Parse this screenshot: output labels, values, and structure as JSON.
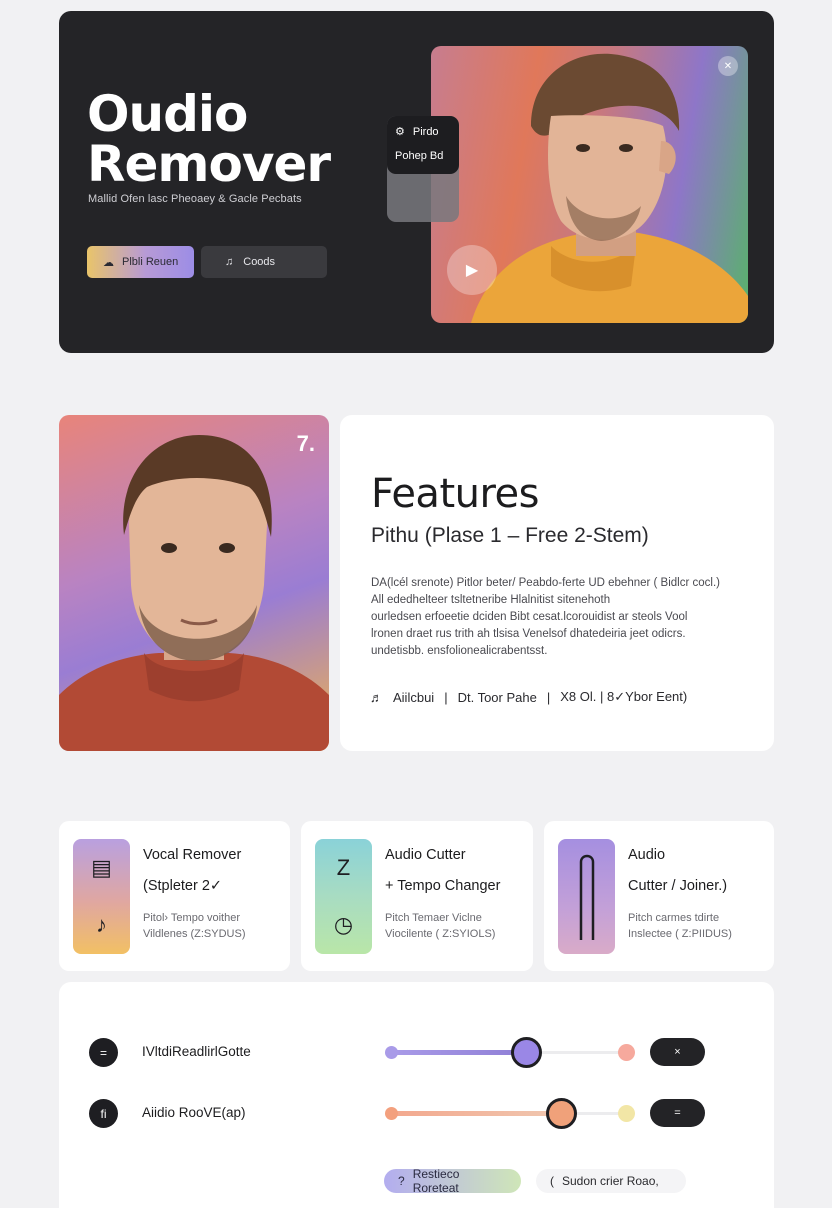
{
  "hero": {
    "title_line1": "Oudio",
    "title_line2": "Remover",
    "subtitle": "Mallid Ofen lasc Pheoaey & Gacle Pecbats",
    "primary_button": "Plbli Reuen",
    "secondary_button": "Coods",
    "float_label1": "Pirdo",
    "float_label2": "Pohep Bd"
  },
  "features": {
    "title": "Features",
    "subtitle": "Pithu (Plase 1 – Free 2-Stem)",
    "body_lines": [
      "DA(lcél srenote) Pitlor beter/ Peabdo-ferte UD ebehner ( Bidlcr cocl.)",
      "All ededhelteer tsltetneribe Hlalnitist sitenehoth",
      "ourledsen erfoeetie dciden Bibt cesat.lcorouidist ar steols Vool",
      "lronen draet rus trith ah tlsisa Venelsof dhatedeiria jeet odicrs.",
      "undetisbb. ensfolionealicrabentsst."
    ],
    "tag1": "Aiilcbui",
    "tag2": "Dt. Toor  Pahe",
    "tag3": "X8 Ol. | 8✓Ybor Eent)"
  },
  "tools": [
    {
      "line1": "Vocal Remover",
      "line2": "(Stpleter 2✓",
      "desc1": "Pitol› Tempo voither",
      "desc2": "Vildlenes (Z:SYDUS)"
    },
    {
      "line1": "Audio Cutter",
      "line2": "+ Tempo Changer",
      "desc1": "Pitch Temaer Viclne",
      "desc2": "Viocilente ( Z:SYIOLS)"
    },
    {
      "line1": "Audio",
      "line2": "Cutter / Joiner.)",
      "desc1": "Pitch carmes tdirte",
      "desc2": "Inslectee ( Z:PIIDUS)"
    }
  ],
  "controls": {
    "row1_label": "IVltdiReadlirlGotte",
    "row1_button": "×",
    "row1_value": 0.57,
    "row2_label": "Aiidio RooVE(ap)",
    "row2_button": "=",
    "row2_value": 0.72,
    "chip1": "Restieco Roreteat",
    "chip2": "Sudon crier Roao,"
  },
  "colors": {
    "hero_bg": "#242427",
    "accent_purple": "#9a87e6",
    "accent_orange": "#f0a17a",
    "page_bg": "#f1f1f3"
  }
}
